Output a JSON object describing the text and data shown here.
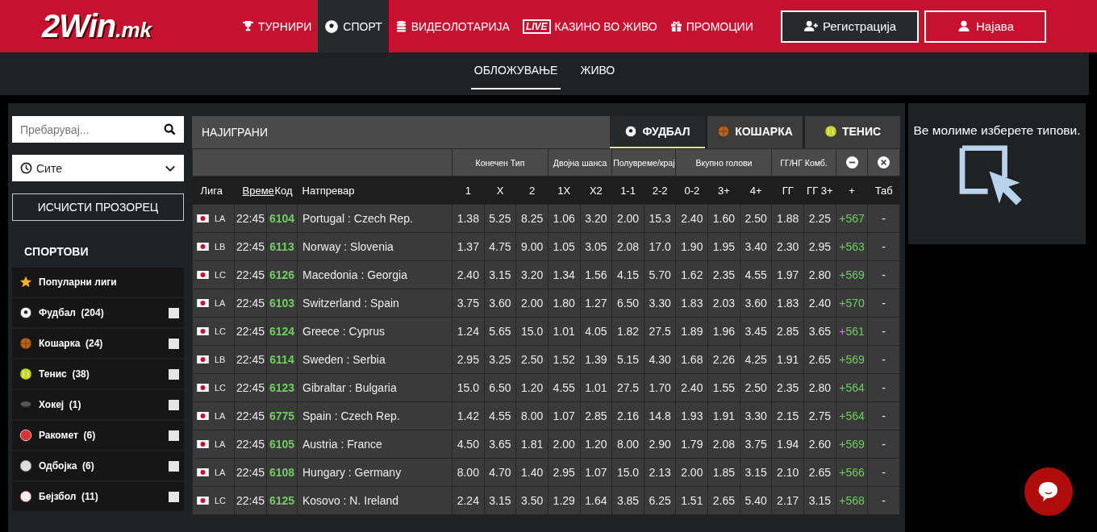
{
  "header": {
    "logo": {
      "name": "2Win",
      "suffix": ".mk"
    },
    "nav": [
      {
        "label": "ТУРНИРИ",
        "kind": "trophy",
        "selected": false
      },
      {
        "label": "СПОРТ",
        "kind": "ball",
        "selected": true
      },
      {
        "label": "ВИДЕОЛОТАРИЈА",
        "kind": "coins",
        "selected": false
      },
      {
        "label": "КАЗИНО ВО ЖИВО",
        "kind": "live",
        "badge": "LIVE",
        "selected": false
      },
      {
        "label": "ПРОМОЦИИ",
        "kind": "gift",
        "selected": false
      }
    ],
    "buttons": [
      {
        "label": "Регистрација",
        "kind": "register"
      },
      {
        "label": "Најава",
        "kind": "login"
      }
    ]
  },
  "subnav": [
    {
      "label": "ОБЛОЖУВАЊЕ",
      "selected": true
    },
    {
      "label": "ЖИВО",
      "selected": false
    }
  ],
  "sidebar": {
    "search": {
      "placeholder": "Пребарувај..."
    },
    "time_filter": {
      "value": "Сите"
    },
    "clear_button": "ИСЧИСТИ ПРОЗОРЕЦ",
    "sports_title": "СПОРТОВИ",
    "sports": [
      {
        "name": "Популарни лиги",
        "kind": "popular"
      },
      {
        "name": "Фудбал",
        "count": "(204)",
        "kind": "football",
        "checked": false
      },
      {
        "name": "Кошарка",
        "count": "(24)",
        "kind": "basketball",
        "checked": false
      },
      {
        "name": "Тенис",
        "count": "(38)",
        "kind": "tennis",
        "checked": false
      },
      {
        "name": "Хокеј",
        "count": "(1)",
        "kind": "hockey",
        "checked": false
      },
      {
        "name": "Ракомет",
        "count": "(6)",
        "kind": "handball",
        "checked": false
      },
      {
        "name": "Одбојка",
        "count": "(6)",
        "kind": "volleyball",
        "checked": false
      },
      {
        "name": "Бејзбол",
        "count": "(11)",
        "kind": "baseball",
        "checked": false
      }
    ]
  },
  "table": {
    "title": "НАЈИГРАНИ",
    "sport_tabs": [
      {
        "label": "ФУДБАЛ",
        "kind": "football",
        "selected": true
      },
      {
        "label": "КОШАРКА",
        "kind": "basketball",
        "selected": false
      },
      {
        "label": "ТЕНИС",
        "kind": "tennis",
        "selected": false
      }
    ],
    "groups": [
      {
        "label": "Конечен Тип"
      },
      {
        "label": "Двојна шанса"
      },
      {
        "label": "Полувреме/крај"
      },
      {
        "label": "Вкупно голови"
      },
      {
        "label": "ГГ/НГ Комб."
      }
    ],
    "columns": [
      {
        "label": "Лига",
        "sortable": false
      },
      {
        "label": "Време",
        "sortable": true
      },
      {
        "label": "Код",
        "sortable": false
      },
      {
        "label": "Натпревар",
        "sortable": false
      },
      {
        "label": "1",
        "sortable": false
      },
      {
        "label": "X",
        "sortable": false
      },
      {
        "label": "2",
        "sortable": false
      },
      {
        "label": "1X",
        "sortable": false
      },
      {
        "label": "X2",
        "sortable": false
      },
      {
        "label": "1-1",
        "sortable": false
      },
      {
        "label": "2-2",
        "sortable": false
      },
      {
        "label": "0-2",
        "sortable": false
      },
      {
        "label": "3+",
        "sortable": false
      },
      {
        "label": "4+",
        "sortable": false
      },
      {
        "label": "ГГ",
        "sortable": false
      },
      {
        "label": "ГГ 3+",
        "sortable": false
      },
      {
        "label": "+",
        "sortable": false
      },
      {
        "label": "Таб",
        "sortable": false
      }
    ],
    "rows": [
      {
        "league": "LA",
        "time": "22:45",
        "code": "6104",
        "match": "Portugal : Czech Rep.",
        "odds": [
          "1.38",
          "5.25",
          "8.25",
          "1.06",
          "3.20",
          "2.00",
          "15.3",
          "2.40",
          "1.60",
          "2.50",
          "1.88",
          "2.25"
        ],
        "more": "+567",
        "tab": "-"
      },
      {
        "league": "LB",
        "time": "22:45",
        "code": "6113",
        "match": "Norway : Slovenia",
        "odds": [
          "1.37",
          "4.75",
          "9.00",
          "1.05",
          "3.05",
          "2.08",
          "17.0",
          "1.90",
          "1.95",
          "3.40",
          "2.30",
          "2.95"
        ],
        "more": "+563",
        "tab": "-"
      },
      {
        "league": "LC",
        "time": "22:45",
        "code": "6126",
        "match": "Macedonia : Georgia",
        "odds": [
          "2.40",
          "3.15",
          "3.20",
          "1.34",
          "1.56",
          "4.15",
          "5.70",
          "1.62",
          "2.35",
          "4.55",
          "1.97",
          "2.80"
        ],
        "more": "+569",
        "tab": "-"
      },
      {
        "league": "LA",
        "time": "22:45",
        "code": "6103",
        "match": "Switzerland : Spain",
        "odds": [
          "3.75",
          "3.60",
          "2.00",
          "1.80",
          "1.27",
          "6.50",
          "3.30",
          "1.83",
          "2.03",
          "3.60",
          "1.83",
          "2.40"
        ],
        "more": "+570",
        "tab": "-"
      },
      {
        "league": "LC",
        "time": "22:45",
        "code": "6124",
        "match": "Greece : Cyprus",
        "odds": [
          "1.24",
          "5.65",
          "15.0",
          "1.01",
          "4.05",
          "1.82",
          "27.5",
          "1.89",
          "1.96",
          "3.45",
          "2.85",
          "3.65"
        ],
        "more": "+561",
        "tab": "-"
      },
      {
        "league": "LB",
        "time": "22:45",
        "code": "6114",
        "match": "Sweden : Serbia",
        "odds": [
          "2.95",
          "3.25",
          "2.50",
          "1.52",
          "1.39",
          "5.15",
          "4.30",
          "1.68",
          "2.26",
          "4.25",
          "1.91",
          "2.65"
        ],
        "more": "+569",
        "tab": "-"
      },
      {
        "league": "LC",
        "time": "22:45",
        "code": "6123",
        "match": "Gibraltar : Bulgaria",
        "odds": [
          "15.0",
          "6.50",
          "1.20",
          "4.55",
          "1.01",
          "27.5",
          "1.70",
          "2.40",
          "1.55",
          "2.50",
          "2.35",
          "2.80"
        ],
        "more": "+564",
        "tab": "-"
      },
      {
        "league": "LA",
        "time": "22:45",
        "code": "6775",
        "match": "Spain : Czech Rep.",
        "odds": [
          "1.42",
          "4.55",
          "8.00",
          "1.07",
          "2.85",
          "2.16",
          "14.8",
          "1.93",
          "1.91",
          "3.30",
          "2.15",
          "2.75"
        ],
        "more": "+564",
        "tab": "-"
      },
      {
        "league": "LA",
        "time": "22:45",
        "code": "6105",
        "match": "Austria : France",
        "odds": [
          "4.50",
          "3.65",
          "1.81",
          "2.00",
          "1.20",
          "8.00",
          "2.90",
          "1.79",
          "2.08",
          "3.75",
          "1.94",
          "2.60"
        ],
        "more": "+569",
        "tab": "-"
      },
      {
        "league": "LA",
        "time": "22:45",
        "code": "6108",
        "match": "Hungary : Germany",
        "odds": [
          "8.00",
          "4.70",
          "1.40",
          "2.95",
          "1.07",
          "15.0",
          "2.13",
          "2.00",
          "1.85",
          "3.15",
          "2.10",
          "2.65"
        ],
        "more": "+566",
        "tab": "-"
      },
      {
        "league": "LC",
        "time": "22:45",
        "code": "6125",
        "match": "Kosovo : N. Ireland",
        "odds": [
          "2.24",
          "3.15",
          "3.50",
          "1.29",
          "1.64",
          "3.85",
          "6.25",
          "1.51",
          "2.65",
          "5.40",
          "2.17",
          "3.15"
        ],
        "more": "+568",
        "tab": "-"
      }
    ]
  },
  "betslip": {
    "message": "Ве молиме изберете типови."
  }
}
